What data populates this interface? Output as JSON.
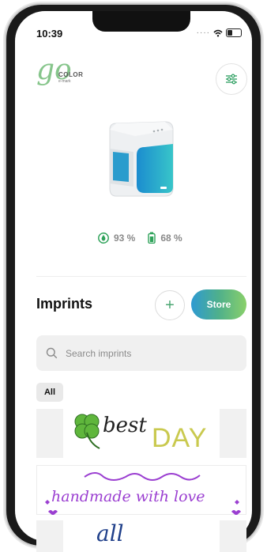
{
  "status": {
    "time": "10:39"
  },
  "header": {
    "logo": {
      "main": "go",
      "brand": "COLOR",
      "sub": "e-mark",
      "icon": "go-color-logo"
    },
    "settings_icon": "sliders-icon"
  },
  "device": {
    "icon": "printer-device-image"
  },
  "levels": {
    "ink_percent": "93 %",
    "battery_percent": "68 %",
    "ink_icon": "ink-drop-icon",
    "battery_icon": "battery-icon",
    "accent_color": "#2fa35a"
  },
  "imprints": {
    "title": "Imprints",
    "add_label": "+",
    "store_label": "Store",
    "search_placeholder": "Search imprints",
    "filters": [
      "All"
    ],
    "items": [
      {
        "text_a": "best",
        "text_b": "DAY",
        "icon": "clover-icon"
      },
      {
        "text": "handmade with love"
      },
      {
        "text": "all"
      }
    ]
  }
}
